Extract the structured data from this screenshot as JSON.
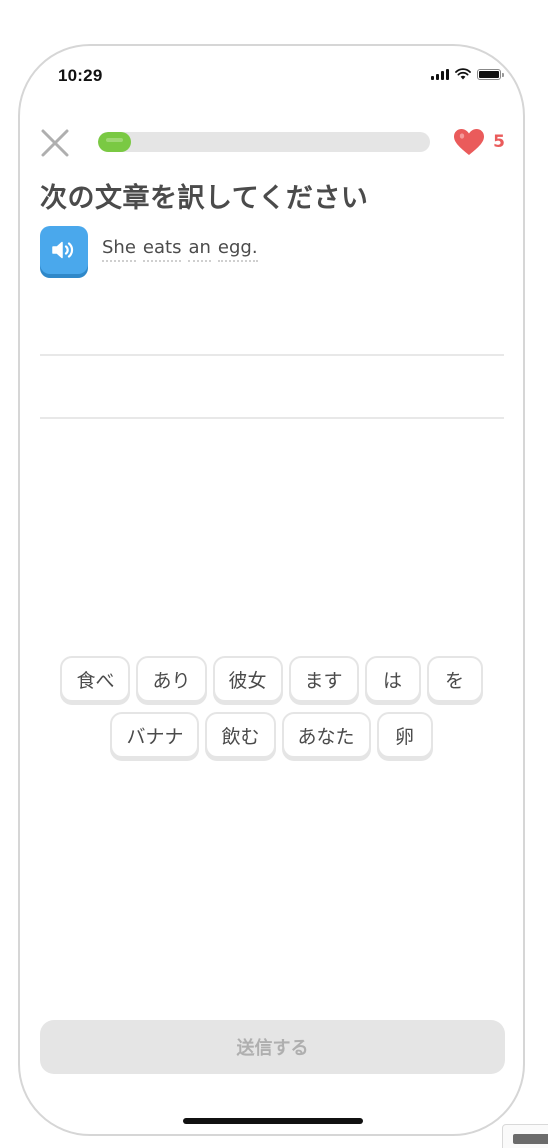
{
  "status_bar": {
    "time": "10:29",
    "icons": [
      "cellular-signal-icon",
      "wifi-icon",
      "battery-icon"
    ]
  },
  "header": {
    "close_icon": "close-icon",
    "progress": {
      "fraction": 0.1,
      "color": "#7ac943",
      "track_color": "#e5e5e5"
    },
    "hearts": {
      "icon": "heart-icon",
      "count": "5",
      "color": "#ea5b5b"
    }
  },
  "prompt": {
    "title": "次の文章を訳してください",
    "speaker_icon": "speaker-icon",
    "speaker_color": "#4aa8ec",
    "sentence_words": [
      "She",
      "eats",
      "an",
      "egg."
    ]
  },
  "word_bank": {
    "rows": [
      [
        "食べ",
        "あり",
        "彼女",
        "ます",
        "は",
        "を"
      ],
      [
        "バナナ",
        "飲む",
        "あなた",
        "卵"
      ]
    ]
  },
  "footer": {
    "submit_label": "送信する",
    "submit_enabled": false
  }
}
